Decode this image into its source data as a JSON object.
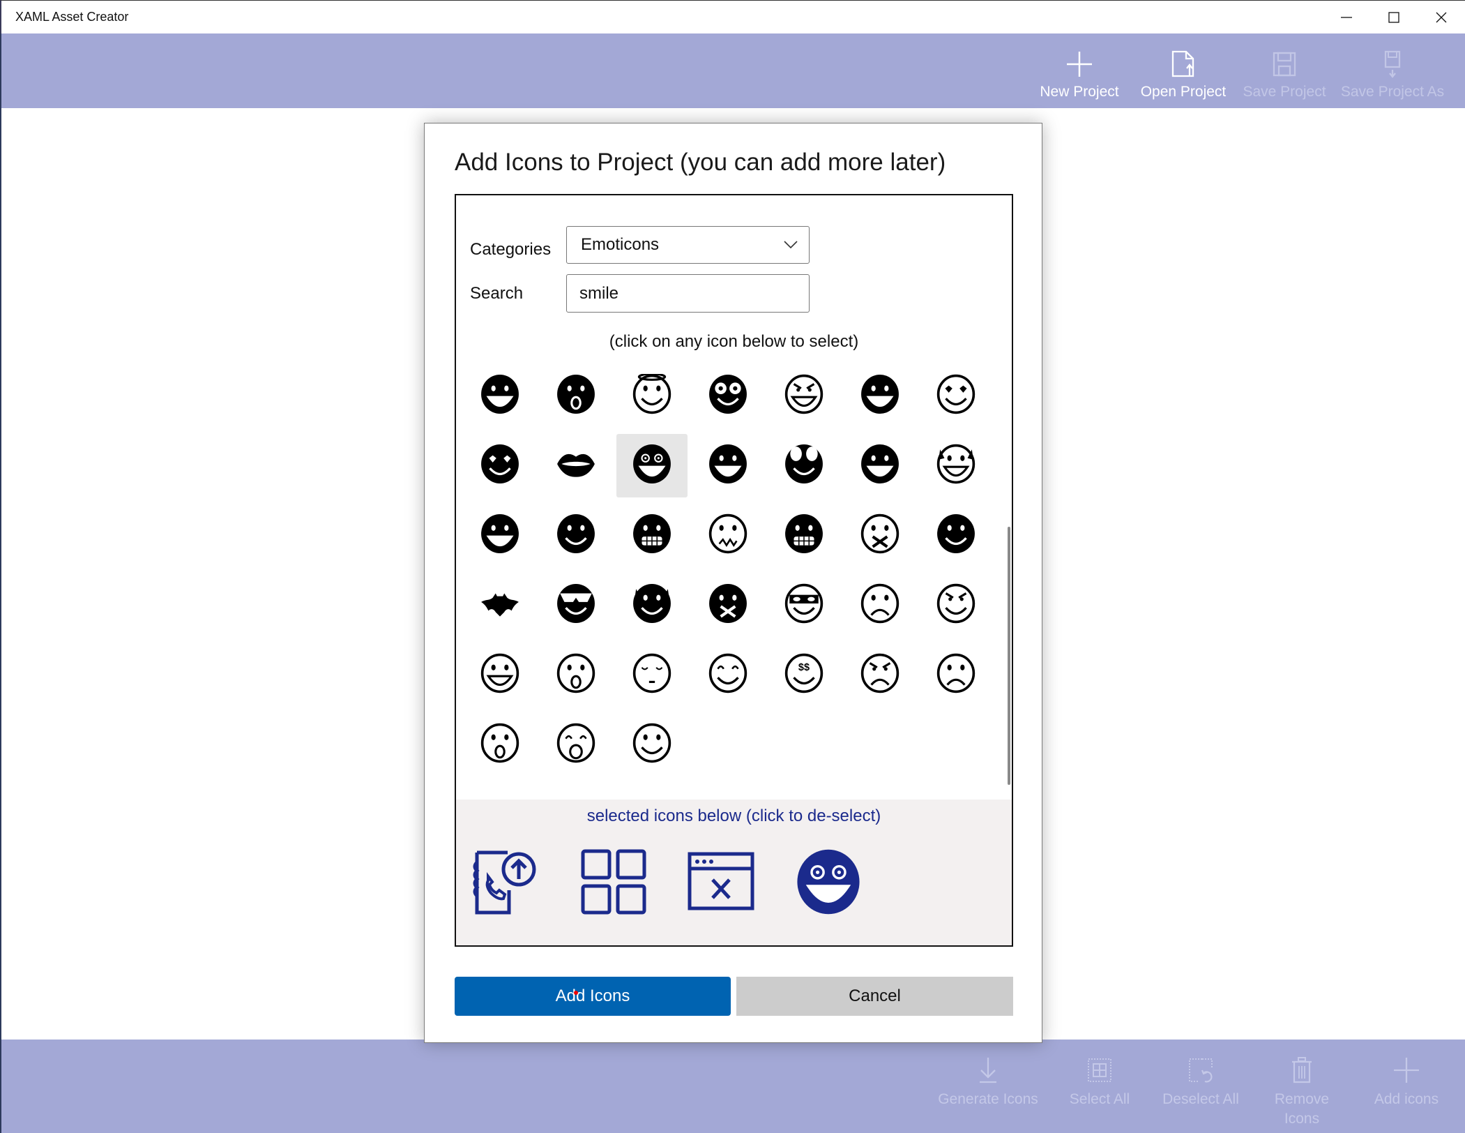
{
  "window": {
    "title": "XAML Asset Creator",
    "controls": [
      "minimize",
      "maximize",
      "close"
    ]
  },
  "top_toolbar": {
    "buttons": [
      {
        "label": "New Project",
        "icon": "plus-icon",
        "enabled": true
      },
      {
        "label": "Open Project",
        "icon": "open-file-icon",
        "enabled": true
      },
      {
        "label": "Save Project",
        "icon": "save-icon",
        "enabled": false
      },
      {
        "label": "Save Project As",
        "icon": "save-as-icon",
        "enabled": false
      }
    ]
  },
  "bottom_toolbar": {
    "buttons": [
      {
        "label": "Generate Icons",
        "icon": "download-icon",
        "enabled": false
      },
      {
        "label": "Select All",
        "icon": "select-all-icon",
        "enabled": false
      },
      {
        "label": "Deselect All",
        "icon": "deselect-all-icon",
        "enabled": false
      },
      {
        "label": "Remove Icons",
        "icon": "trash-icon",
        "enabled": false
      },
      {
        "label": "Add icons",
        "icon": "plus-icon",
        "enabled": false
      }
    ]
  },
  "dialog": {
    "title": "Add Icons to Project (you can add more later)",
    "categories_label": "Categories",
    "categories_value": "Emoticons",
    "search_label": "Search",
    "search_value": "smile",
    "grid_hint": "(click on any icon below to select)",
    "grid_icons": [
      [
        "emoji-partial-1",
        "emoji-partial-2",
        "emoji-partial-3",
        "emoji-partial-4",
        "emoji-partial-5",
        "emoji-partial-6",
        "emoji-partial-7"
      ],
      [
        "laughing-face-icon",
        "surprised-face-icon",
        "angel-face-icon",
        "goggle-eyes-face-icon",
        "angry-grin-face-icon",
        "tongue-lick-face-icon",
        "heart-eyes-face-icon"
      ],
      [
        "heart-eyes-filled-icon",
        "lips-icon",
        "dizzy-face-icon",
        "squint-laugh-face-icon",
        "big-eyes-face-icon",
        "vampire-face-icon",
        "devil-face-icon"
      ],
      [
        "tongue-out-face-icon",
        "smile-filled-icon",
        "grimace-face-icon",
        "confused-face-icon",
        "zipper-mouth-face-icon",
        "mouth-x-face-icon",
        "smoking-face-icon"
      ],
      [
        "bat-icon",
        "cool-face-icon",
        "devil-cat-icon",
        "gagged-face-icon",
        "masked-face-icon",
        "sad-face-icon",
        "angry-face-icon"
      ],
      [
        "grin-face-icon",
        "shocked-face-icon",
        "sleepy-face-icon",
        "happy-eyes-face-icon",
        "money-eyes-face-icon",
        "frown-face-icon",
        "worried-face-icon"
      ],
      [
        "gasp-face-icon",
        "yawn-face-icon",
        "simple-smile-icon"
      ]
    ],
    "highlighted_icon": "dizzy-face-icon",
    "selected_hint": "selected icons below (click to de-select)",
    "selected_icons": [
      "contact-phone-upload-icon",
      "grid-four-icon",
      "window-close-icon",
      "dizzy-face-icon"
    ],
    "add_button": "Add Icons",
    "cancel_button": "Cancel"
  },
  "colors": {
    "toolbar_bg": "#a3a8d6",
    "primary_button": "#0063b1",
    "secondary_button": "#cccccc",
    "selected_icon_color": "#1b2a8c",
    "selected_area_bg": "#f3f0f0"
  }
}
